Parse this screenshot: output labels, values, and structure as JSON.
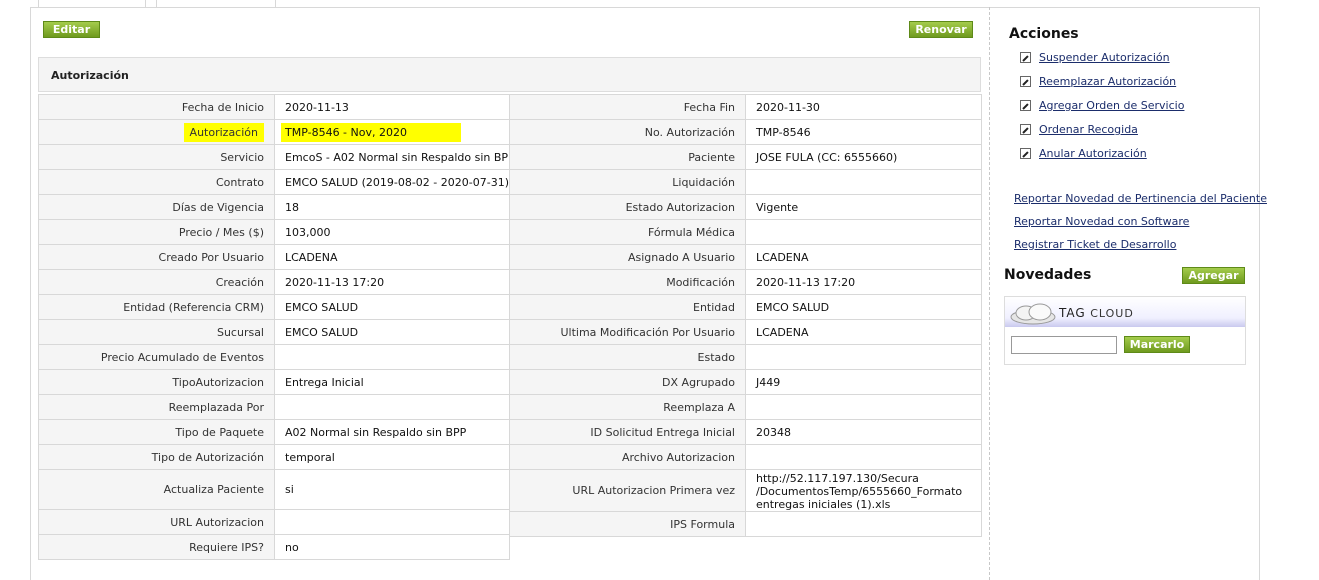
{
  "toolbar": {
    "edit_label": "Editar",
    "renew_label": "Renovar"
  },
  "panel": {
    "title": "Autorización"
  },
  "left_rows": [
    {
      "label": "Fecha de Inicio",
      "value": "2020-11-13"
    },
    {
      "label": "Autorización",
      "value": "TMP-8546 - Nov, 2020",
      "highlight": true
    },
    {
      "label": "Servicio",
      "value": "EmcoS - A02 Normal sin Respaldo sin BPP"
    },
    {
      "label": "Contrato",
      "value": "EMCO SALUD (2019-08-02 - 2020-07-31)"
    },
    {
      "label": "Días de Vigencia",
      "value": "18"
    },
    {
      "label": "Precio / Mes ($)",
      "value": "103,000"
    },
    {
      "label": "Creado Por Usuario",
      "value": "LCADENA"
    },
    {
      "label": "Creación",
      "value": "2020-11-13 17:20"
    },
    {
      "label": "Entidad (Referencia CRM)",
      "value": "EMCO SALUD"
    },
    {
      "label": "Sucursal",
      "value": "EMCO SALUD"
    },
    {
      "label": "Precio Acumulado de Eventos",
      "value": ""
    },
    {
      "label": "TipoAutorizacion",
      "value": "Entrega Inicial"
    },
    {
      "label": "Reemplazada Por",
      "value": ""
    },
    {
      "label": "Tipo de Paquete",
      "value": "A02 Normal sin Respaldo sin BPP"
    },
    {
      "label": "Tipo de Autorización",
      "value": "temporal"
    },
    {
      "label": "Actualiza Paciente",
      "value": "si",
      "tall": true
    },
    {
      "label": "URL Autorizacion",
      "value": ""
    },
    {
      "label": "Requiere IPS?",
      "value": "no"
    }
  ],
  "right_rows": [
    {
      "label": "Fecha Fin",
      "value": "2020-11-30"
    },
    {
      "label": "No. Autorización",
      "value": "TMP-8546"
    },
    {
      "label": "Paciente",
      "value": "JOSE FULA (CC: 6555660)"
    },
    {
      "label": "Liquidación",
      "value": ""
    },
    {
      "label": "Estado Autorizacion",
      "value": "Vigente"
    },
    {
      "label": "Fórmula Médica",
      "value": ""
    },
    {
      "label": "Asignado A Usuario",
      "value": "LCADENA"
    },
    {
      "label": "Modificación",
      "value": "2020-11-13 17:20"
    },
    {
      "label": "Entidad",
      "value": "EMCO SALUD"
    },
    {
      "label": "Ultima Modificación Por Usuario",
      "value": "LCADENA"
    },
    {
      "label": "Estado",
      "value": ""
    },
    {
      "label": "DX Agrupado",
      "value": "J449"
    },
    {
      "label": "Reemplaza A",
      "value": ""
    },
    {
      "label": "ID Solicitud Entrega Inicial",
      "value": "20348"
    },
    {
      "label": "Archivo Autorizacion",
      "value": ""
    },
    {
      "label": "URL Autorizacion Primera vez",
      "value": "http://52.117.197.130/Secura/DocumentosTemp/6555660_Formato entregas iniciales (1).xls",
      "tall": true,
      "url_lines": [
        "http://52.117.197.130/Secura",
        "/DocumentosTemp/6555660_Formato",
        "entregas iniciales (1).xls"
      ]
    },
    {
      "label": "IPS Formula",
      "value": ""
    }
  ],
  "sidebar": {
    "actions_title": "Acciones",
    "actions": [
      "Suspender Autorización",
      "Reemplazar Autorización",
      "Agregar Orden de Servicio",
      "Ordenar Recogida",
      "Anular Autorización"
    ],
    "links": [
      "Reportar Novedad de Pertinencia del Paciente",
      "Reportar Novedad con Software",
      "Registrar Ticket de Desarrollo"
    ],
    "novedades_title": "Novedades",
    "add_label": "Agregar",
    "tag_cloud": {
      "word1": "TAG",
      "word2": "CLOUD",
      "input_value": "",
      "mark_label": "Marcarlo"
    }
  },
  "colors": {
    "button_green": "#7ca82a",
    "highlight": "#ffff00",
    "link": "#1b2d6b"
  }
}
